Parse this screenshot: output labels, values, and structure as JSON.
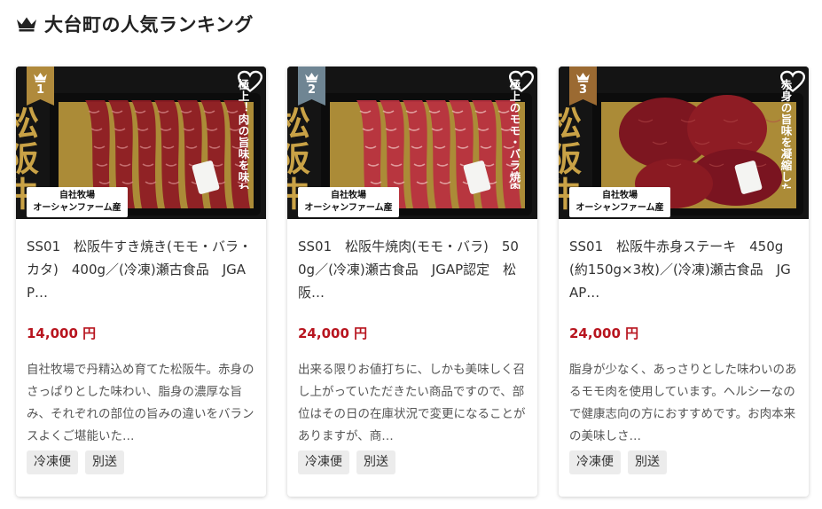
{
  "section": {
    "title": "大台町の人気ランキング",
    "icon": "crown-icon"
  },
  "products": [
    {
      "rank": "1",
      "rank_color": "#b08a3c",
      "name": "SS01　松阪牛すき焼き(モモ・バラ・カタ)　400g／(冷凍)瀬古食品　JGAP…",
      "price": "14,000 円",
      "description": "自社牧場で丹精込め育てた松阪牛。赤身のさっぱりとした味わい、脂身の濃厚な旨み、それぞれの部位の旨みの違いをバランスよくご堪能いた…",
      "tags": [
        "冷凍便",
        "別送"
      ],
      "image": {
        "kanji": "松阪牛",
        "tagline": "極上！肉の旨味を味わいつくす",
        "farm_line1": "自社牧場",
        "farm_line2": "オーシャンファーム産"
      }
    },
    {
      "rank": "2",
      "rank_color": "#6f8593",
      "name": "SS01　松阪牛焼肉(モモ・バラ)　500g／(冷凍)瀬古食品　JGAP認定　松阪…",
      "price": "24,000 円",
      "description": "出来る限りお値打ちに、しかも美味しく召し上がっていただきたい商品ですので、部位はその日の在庫状況で変更になることがありますが、商…",
      "tags": [
        "冷凍便",
        "別送"
      ],
      "image": {
        "kanji": "松阪牛",
        "tagline": "極上のモモ・バラ焼肉をご家庭で",
        "farm_line1": "自社牧場",
        "farm_line2": "オーシャンファーム産"
      }
    },
    {
      "rank": "3",
      "rank_color": "#9b6a32",
      "name": "SS01　松阪牛赤身ステーキ　450g(約150g×3枚)／(冷凍)瀬古食品　JGAP…",
      "price": "24,000 円",
      "description": "脂身が少なく、あっさりとした味わいのあるモモ肉を使用しています。ヘルシーなので健康志向の方におすすめです。お肉本来の美味しさ…",
      "tags": [
        "冷凍便",
        "別送"
      ],
      "image": {
        "kanji": "松阪牛",
        "tagline": "赤身の旨味を凝縮したステーキ肉",
        "farm_line1": "自社牧場",
        "farm_line2": "オーシャンファーム産"
      }
    }
  ]
}
